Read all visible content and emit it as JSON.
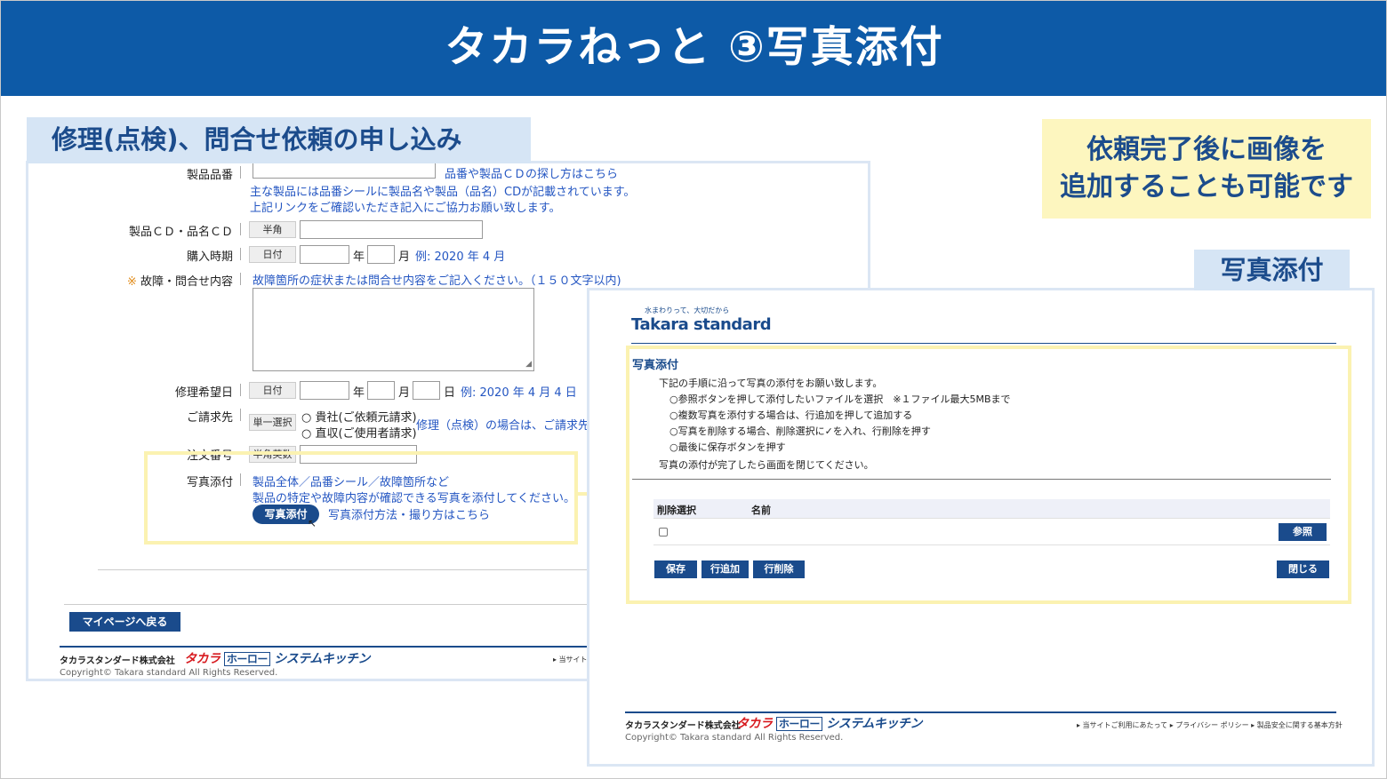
{
  "slide": {
    "title": "タカラねっと ③写真添付"
  },
  "section_label": "修理(点検)、問合せ依頼の申し込み",
  "note": {
    "line1": "依頼完了後に画像を",
    "line2": "追加することも可能です"
  },
  "photo_label": "写真添付",
  "form": {
    "product_no": {
      "label": "製品品番",
      "link": "品番や製品ＣＤの探し方はこちら",
      "note1": "主な製品には品番シールに製品名や製品（品名）CDが記載されています。",
      "note2": "上記リンクをご確認いただき記入にご協力お願い致します。"
    },
    "product_cd": {
      "label": "製品ＣＤ・品名ＣＤ",
      "tag": "半角"
    },
    "purchase": {
      "label": "購入時期",
      "tag": "日付",
      "year_unit": "年",
      "month_unit": "月",
      "example": "例: 2020 年 4 月"
    },
    "issue": {
      "mark": "※",
      "label": "故障・問合せ内容",
      "hint": "故障箇所の症状または問合せ内容をご記入ください。（１５０文字以内)"
    },
    "repair_date": {
      "label": "修理希望日",
      "tag": "日付",
      "year_unit": "年",
      "month_unit": "月",
      "day_unit": "日",
      "example": "例: 2020 年 4 月 4 日"
    },
    "billing": {
      "label": "ご請求先",
      "tag": "単一選択",
      "option1": "貴社(ご依頼元請求)",
      "option2": "直収(ご使用者請求)",
      "note": "修理（点検）の場合は、ご請求先を"
    },
    "order_no": {
      "label": "注文番号",
      "tag": "半角英数"
    },
    "photo": {
      "label": "写真添付",
      "line1": "製品全体／品番シール／故障箇所など",
      "line2": "製品の特定や故障内容が確認できる写真を添付してください。",
      "button": "写真添付",
      "link": "写真添付方法・撮り方はこちら"
    },
    "mypage_button": "マイページへ戻る"
  },
  "footer": {
    "company": "タカラスタンダード株式会社",
    "brand_taka": "タカラ",
    "brand_horo": "ホーロー",
    "brand_kitchen": "システムキッチン",
    "copyright": "Copyright© Takara standard All Rights Reserved.",
    "link_site_short": "▸ 当サイト",
    "links": "▸ 当サイトご利用にあたって ▸ プライバシー ポリシー ▸ 製品安全に関する基本方針"
  },
  "popup": {
    "tagline": "水まわりって、大切だから",
    "logo": "Takara standard",
    "title": "写真添付",
    "intro": "下記の手順に沿って写真の添付をお願い致します。",
    "steps": [
      "○参照ボタンを押して添付したいファイルを選択　※１ファイル最大5MBまで",
      "○複数写真を添付する場合は、行追加を押して追加する",
      "○写真を削除する場合、削除選択に✓を入れ、行削除を押す",
      "○最後に保存ボタンを押す"
    ],
    "closing": "写真の添付が完了したら画面を閉じてください。",
    "table": {
      "col_delete": "削除選択",
      "col_name": "名前"
    },
    "browse_button": "参照",
    "save_button": "保存",
    "add_row_button": "行追加",
    "delete_row_button": "行削除",
    "close_button": "閉じる"
  }
}
